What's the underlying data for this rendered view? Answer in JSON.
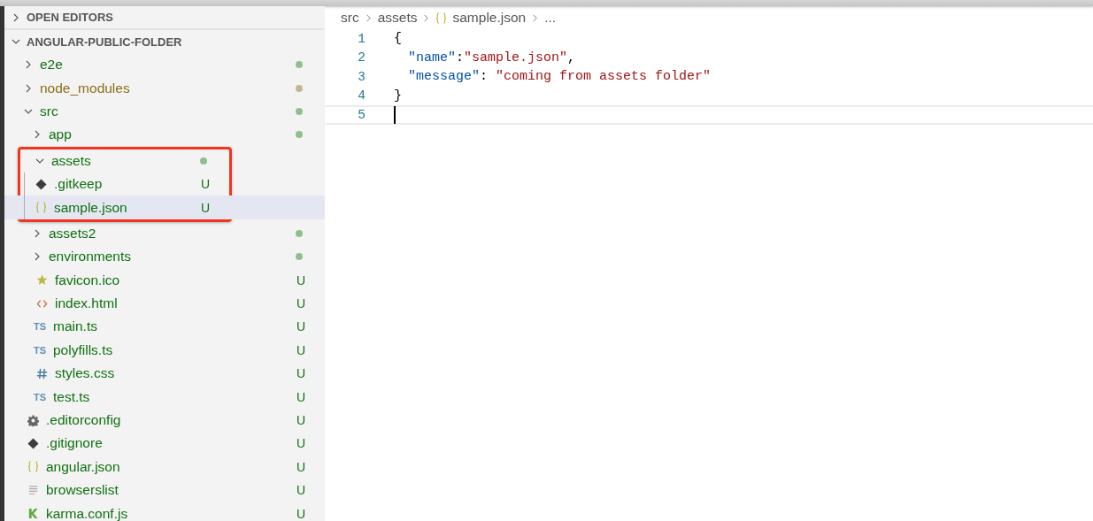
{
  "sidebar": {
    "sections": [
      {
        "title": "OPEN EDITORS",
        "expanded": false
      },
      {
        "title": "ANGULAR-PUBLIC-FOLDER",
        "expanded": true
      }
    ],
    "tree": [
      {
        "name": "e2e",
        "kind": "folder",
        "expanded": false,
        "ignored": false,
        "color": "#8fbf8f",
        "selected": false
      },
      {
        "name": "node_modules",
        "kind": "folder",
        "expanded": false,
        "ignored": true,
        "color": "#c8b58f",
        "selected": false
      },
      {
        "name": "src",
        "kind": "folder",
        "expanded": true,
        "ignored": false,
        "color": "#8fbf8f",
        "selected": false,
        "children": [
          {
            "name": "app",
            "kind": "folder",
            "expanded": false,
            "ignored": false,
            "color": "#8fbf8f",
            "selected": false
          },
          {
            "name": "assets",
            "kind": "folder",
            "expanded": true,
            "highlighted": true,
            "ignored": false,
            "color": "#8fbf8f",
            "selected": false,
            "children": [
              {
                "name": ".gitkeep",
                "kind": "git",
                "ignored": false,
                "badge": "U",
                "selected": false
              },
              {
                "name": "sample.json",
                "kind": "json",
                "ignored": false,
                "badge": "U",
                "selected": true
              }
            ]
          },
          {
            "name": "assets2",
            "kind": "folder",
            "expanded": false,
            "ignored": false,
            "color": "#8fbf8f",
            "selected": false
          },
          {
            "name": "environments",
            "kind": "folder",
            "expanded": false,
            "ignored": false,
            "color": "#8fbf8f",
            "selected": false
          },
          {
            "name": "favicon.ico",
            "kind": "star",
            "ignored": false,
            "badge": "U",
            "selected": false
          },
          {
            "name": "index.html",
            "kind": "html",
            "ignored": false,
            "badge": "U",
            "selected": false
          },
          {
            "name": "main.ts",
            "kind": "ts",
            "icon_text": "TS",
            "ignored": false,
            "badge": "U",
            "selected": false
          },
          {
            "name": "polyfills.ts",
            "kind": "ts",
            "icon_text": "TS",
            "ignored": false,
            "badge": "U",
            "selected": false
          },
          {
            "name": "styles.css",
            "kind": "hash",
            "ignored": false,
            "badge": "U",
            "selected": false
          },
          {
            "name": "test.ts",
            "kind": "ts",
            "icon_text": "TS",
            "ignored": false,
            "badge": "U",
            "selected": false
          }
        ]
      },
      {
        "name": ".editorconfig",
        "kind": "gear",
        "ignored": false,
        "badge": "U",
        "selected": false
      },
      {
        "name": ".gitignore",
        "kind": "git",
        "ignored": false,
        "badge": "U",
        "selected": false
      },
      {
        "name": "angular.json",
        "kind": "json",
        "ignored": false,
        "badge": "U",
        "selected": false
      },
      {
        "name": "browserslist",
        "kind": "lines",
        "ignored": false,
        "badge": "U",
        "selected": false
      },
      {
        "name": "karma.conf.js",
        "kind": "karma",
        "ignored": false,
        "badge": "U",
        "selected": false
      }
    ]
  },
  "editor": {
    "breadcrumb": [
      {
        "text": "src",
        "kind": "plain"
      },
      {
        "text": "assets",
        "kind": "plain"
      },
      {
        "text": "sample.json",
        "kind": "json"
      },
      {
        "text": "...",
        "kind": "plain"
      }
    ],
    "lines": [
      {
        "number": "1",
        "tokens": [
          {
            "kind": "punct",
            "text": "{"
          }
        ]
      },
      {
        "number": "2",
        "tokens": [
          {
            "kind": "key",
            "text": "\"name\""
          },
          {
            "kind": "punct",
            "text": ":"
          },
          {
            "kind": "string",
            "text": "\"sample.json\""
          },
          {
            "kind": "punct",
            "text": ","
          }
        ]
      },
      {
        "number": "3",
        "tokens": [
          {
            "kind": "key",
            "text": "\"message\""
          },
          {
            "kind": "punct",
            "text": ":"
          },
          {
            "kind": "string",
            "text": "\"coming from assets folder\""
          }
        ]
      },
      {
        "number": "4",
        "tokens": [
          {
            "kind": "punct",
            "text": "}"
          }
        ]
      },
      {
        "number": "5",
        "current": true
      }
    ]
  }
}
